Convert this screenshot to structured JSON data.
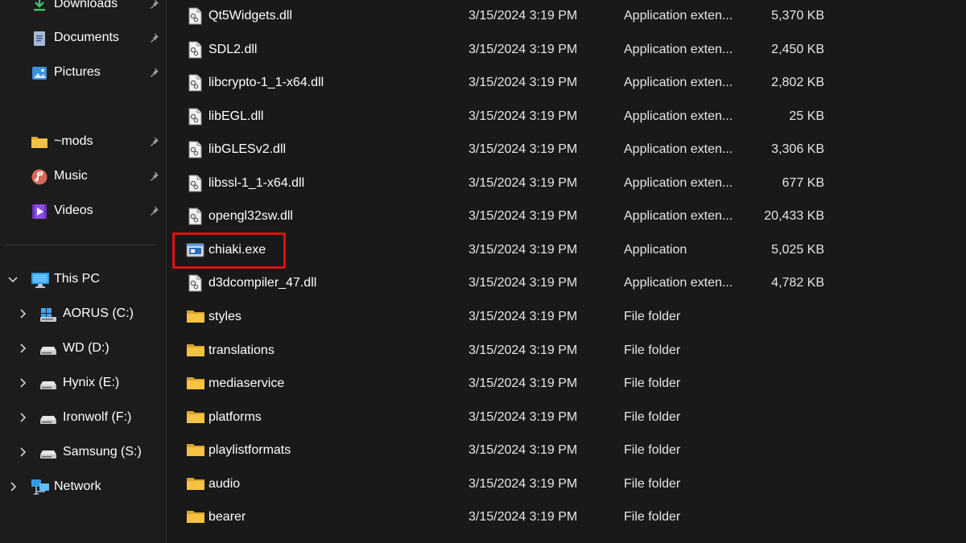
{
  "sidebar": {
    "quick_access": [
      {
        "label": "Downloads",
        "icon": "download-icon",
        "pinned": true
      },
      {
        "label": "Documents",
        "icon": "documents-icon",
        "pinned": true
      },
      {
        "label": "Pictures",
        "icon": "pictures-icon",
        "pinned": true
      },
      {
        "label": "~mods",
        "icon": "folder-icon",
        "pinned": true
      },
      {
        "label": "Music",
        "icon": "music-icon",
        "pinned": true
      },
      {
        "label": "Videos",
        "icon": "videos-icon",
        "pinned": true
      }
    ],
    "this_pc": {
      "label": "This PC",
      "icon": "monitor-icon",
      "expanded": true
    },
    "drives": [
      {
        "label": "AORUS (C:)",
        "icon": "windows-drive-icon"
      },
      {
        "label": "WD (D:)",
        "icon": "drive-icon"
      },
      {
        "label": "Hynix (E:)",
        "icon": "drive-icon"
      },
      {
        "label": "Ironwolf (F:)",
        "icon": "drive-icon"
      },
      {
        "label": "Samsung (S:)",
        "icon": "drive-icon"
      }
    ],
    "network": {
      "label": "Network",
      "icon": "network-icon",
      "expanded": false
    }
  },
  "files": [
    {
      "name": "Qt5Widgets.dll",
      "date": "3/15/2024 3:19 PM",
      "type": "Application exten...",
      "size": "5,370 KB",
      "icon": "dll-file-icon"
    },
    {
      "name": "SDL2.dll",
      "date": "3/15/2024 3:19 PM",
      "type": "Application exten...",
      "size": "2,450 KB",
      "icon": "dll-file-icon"
    },
    {
      "name": "libcrypto-1_1-x64.dll",
      "date": "3/15/2024 3:19 PM",
      "type": "Application exten...",
      "size": "2,802 KB",
      "icon": "dll-file-icon"
    },
    {
      "name": "libEGL.dll",
      "date": "3/15/2024 3:19 PM",
      "type": "Application exten...",
      "size": "25 KB",
      "icon": "dll-file-icon"
    },
    {
      "name": "libGLESv2.dll",
      "date": "3/15/2024 3:19 PM",
      "type": "Application exten...",
      "size": "3,306 KB",
      "icon": "dll-file-icon"
    },
    {
      "name": "libssl-1_1-x64.dll",
      "date": "3/15/2024 3:19 PM",
      "type": "Application exten...",
      "size": "677 KB",
      "icon": "dll-file-icon"
    },
    {
      "name": "opengl32sw.dll",
      "date": "3/15/2024 3:19 PM",
      "type": "Application exten...",
      "size": "20,433 KB",
      "icon": "dll-file-icon"
    },
    {
      "name": "chiaki.exe",
      "date": "3/15/2024 3:19 PM",
      "type": "Application",
      "size": "5,025 KB",
      "icon": "exe-file-icon",
      "highlighted": true
    },
    {
      "name": "d3dcompiler_47.dll",
      "date": "3/15/2024 3:19 PM",
      "type": "Application exten...",
      "size": "4,782 KB",
      "icon": "dll-file-icon"
    },
    {
      "name": "styles",
      "date": "3/15/2024 3:19 PM",
      "type": "File folder",
      "size": "",
      "icon": "folder-icon"
    },
    {
      "name": "translations",
      "date": "3/15/2024 3:19 PM",
      "type": "File folder",
      "size": "",
      "icon": "folder-icon"
    },
    {
      "name": "mediaservice",
      "date": "3/15/2024 3:19 PM",
      "type": "File folder",
      "size": "",
      "icon": "folder-icon"
    },
    {
      "name": "platforms",
      "date": "3/15/2024 3:19 PM",
      "type": "File folder",
      "size": "",
      "icon": "folder-icon"
    },
    {
      "name": "playlistformats",
      "date": "3/15/2024 3:19 PM",
      "type": "File folder",
      "size": "",
      "icon": "folder-icon"
    },
    {
      "name": "audio",
      "date": "3/15/2024 3:19 PM",
      "type": "File folder",
      "size": "",
      "icon": "folder-icon"
    },
    {
      "name": "bearer",
      "date": "3/15/2024 3:19 PM",
      "type": "File folder",
      "size": "",
      "icon": "folder-icon"
    }
  ],
  "colors": {
    "background": "#191919",
    "sidebar_background": "#1c1c1c",
    "highlight_border": "#e01010",
    "folder_yellow": "#f5c243",
    "accent_blue": "#4ca0e0"
  }
}
